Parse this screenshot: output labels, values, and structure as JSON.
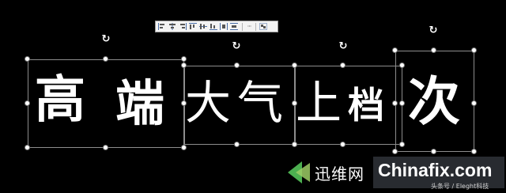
{
  "toolbar": {
    "icons": [
      "align-left-icon",
      "align-center-icon",
      "align-right-icon",
      "align-top-icon",
      "align-middle-icon",
      "align-bottom-icon",
      "distribute-horizontal-icon",
      "distribute-vertical-icon"
    ],
    "more_label": "···"
  },
  "glyphs": [
    "高",
    "端",
    "大",
    "气",
    "上",
    "档",
    "次"
  ],
  "watermark": {
    "brand": "迅维网",
    "site": "Chinafix.com",
    "credit": "头条号 / Eleght科技"
  },
  "colors": {
    "background": "#000000",
    "text": "#ffffff",
    "selection": "#8d8d8d"
  }
}
